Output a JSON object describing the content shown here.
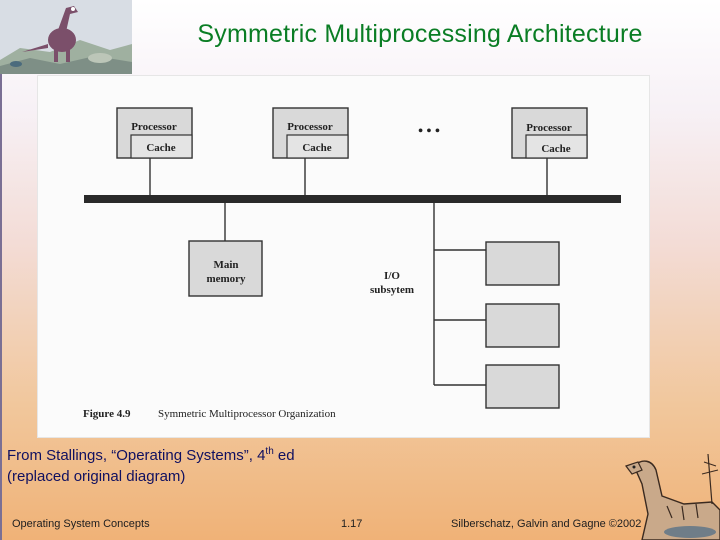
{
  "slide": {
    "title": "Symmetric Multiprocessing Architecture",
    "caption_line1_prefix": "From Stallings, “Operating Systems”, 4",
    "caption_sup": "th",
    "caption_line1_suffix": " ed",
    "caption_line2": "(replaced original diagram)"
  },
  "diagram": {
    "processor_label": "Processor",
    "cache_label": "Cache",
    "ellipsis": "• • •",
    "main_memory_line1": "Main",
    "main_memory_line2": "memory",
    "io_line1": "I/O",
    "io_line2": "subsytem",
    "figure_number": "Figure 4.9",
    "figure_title": "Symmetric Multiprocessor Organization"
  },
  "footer": {
    "left": "Operating System Concepts",
    "center": "1.17",
    "right": "Silberschatz, Galvin and  Gagne ©2002"
  },
  "colors": {
    "title": "#0a7d24",
    "caption": "#101060",
    "box_fill": "#d9d9d9"
  }
}
